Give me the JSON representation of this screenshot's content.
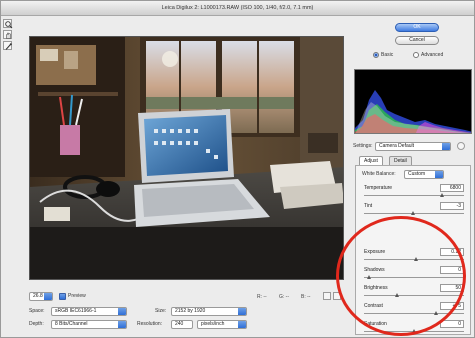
{
  "window": {
    "title": "Leica Digilux 2: L1000173.RAW (ISO 100, 1/40, f/2.0, 7.1 mm)"
  },
  "tools": [
    "zoom-tool-icon",
    "hand-tool-icon",
    "eyedropper-tool-icon"
  ],
  "buttons": {
    "ok": "OK",
    "cancel": "Cancel"
  },
  "mode": {
    "basic": "Basic",
    "advanced": "Advanced",
    "selected": "Basic"
  },
  "settings": {
    "label": "Settings:",
    "value": "Camera Default"
  },
  "tabs": [
    {
      "label": "Adjust",
      "active": true
    },
    {
      "label": "Detail",
      "active": false
    }
  ],
  "white_balance": {
    "label": "White Balance:",
    "value": "Custom"
  },
  "adjustments": [
    {
      "name": "Temperature",
      "value": "6800",
      "position": 0.78
    },
    {
      "name": "Tint",
      "value": "-3",
      "position": 0.49
    },
    {
      "name": "Exposure",
      "value": "0.12",
      "position": 0.52
    },
    {
      "name": "Shadows",
      "value": "0",
      "position": 0.05
    },
    {
      "name": "Brightness",
      "value": "50",
      "position": 0.33
    },
    {
      "name": "Contrast",
      "value": "+75",
      "position": 0.72
    },
    {
      "name": "Saturation",
      "value": "0",
      "position": 0.5
    }
  ],
  "bottom": {
    "zoom": "26.8",
    "preview_label": "Preview",
    "preview_checked": true,
    "rgb_r": "R: --",
    "rgb_g": "G: --",
    "rgb_b": "B: --",
    "space_label": "Space:",
    "space_value": "sRGB IEC61966-1",
    "size_label": "Size:",
    "size_value": "2152 by 1920",
    "depth_label": "Depth:",
    "depth_value": "8 Bits/Channel",
    "resolution_label": "Resolution:",
    "resolution_value": "240",
    "resolution_unit": "pixels/inch"
  },
  "colors": {
    "accent": "#3f7be0",
    "annotation_circle": "#e0281c"
  }
}
